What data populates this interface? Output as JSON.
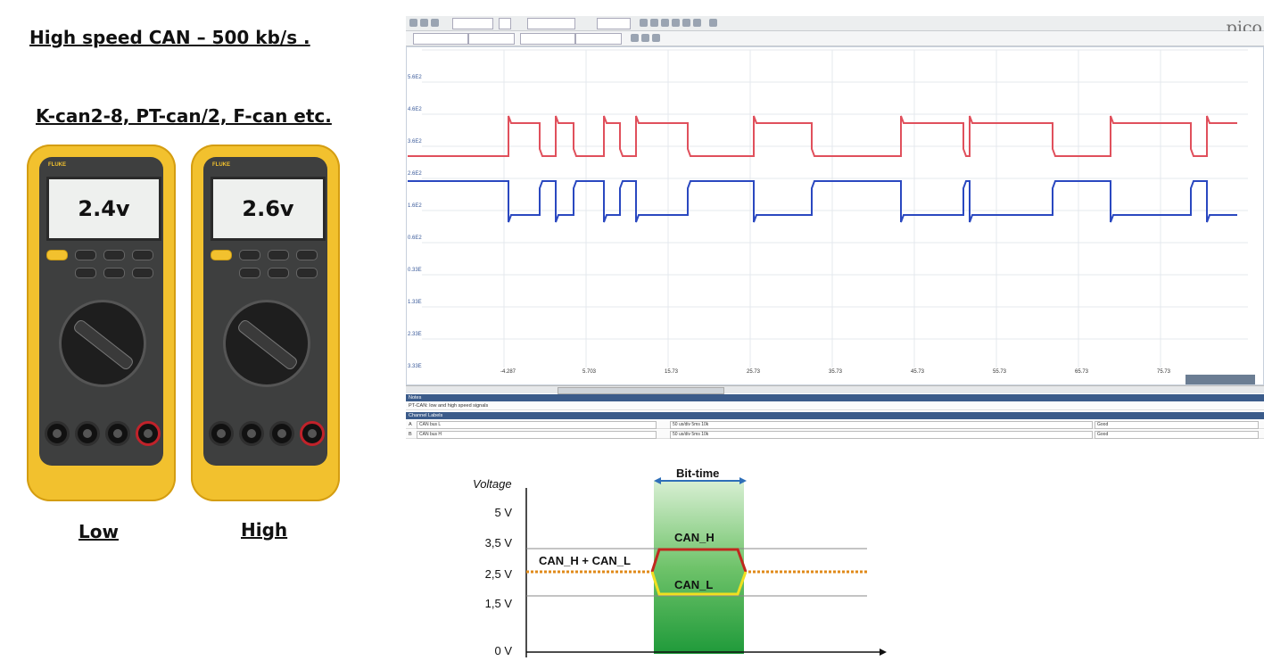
{
  "titles": {
    "main": "High speed CAN – 500 kb/s .",
    "sub": "K-can2-8, PT-can/2, F-can etc."
  },
  "meters": [
    {
      "reading": "2.4v",
      "label": "Low",
      "brand": "FLUKE"
    },
    {
      "reading": "2.6v",
      "label": "High",
      "brand": "FLUKE"
    }
  ],
  "scope": {
    "brand": "pico",
    "left_axis_ticks": [
      "5.6E2",
      "4.6E2",
      "3.6E2",
      "2.6E2",
      "1.6E2",
      "0.6E2",
      "0.33E",
      "1.33E",
      "2.33E",
      "3.33E"
    ],
    "x_axis_ticks": [
      "-4.287",
      "5.703",
      "15.73",
      "25.73",
      "35.73",
      "45.73",
      "55.73",
      "65.73",
      "75.73"
    ],
    "status_header": "Notes",
    "status_text": "PT-CAN: low and high speed signals",
    "channel_header": "Channel Labels",
    "channels": [
      {
        "id": "A",
        "name": "CAN bus L",
        "setting": "50 us/div  5ms  10k",
        "quality": "Good"
      },
      {
        "id": "B",
        "name": "CAN bus H",
        "setting": "50 us/div  5ms  10k",
        "quality": "Good"
      }
    ],
    "colors": {
      "can_h": "#e0505c",
      "can_l": "#2a48c0"
    }
  },
  "diagram": {
    "y_axis_label": "Voltage",
    "y_ticks": [
      "5 V",
      "3,5 V",
      "2,5 V",
      "1,5 V",
      "0 V"
    ],
    "bit_time_label": "Bit-time",
    "can_h_label": "CAN_H",
    "can_l_label": "CAN_L",
    "recessive_label": "CAN_H + CAN_L"
  }
}
